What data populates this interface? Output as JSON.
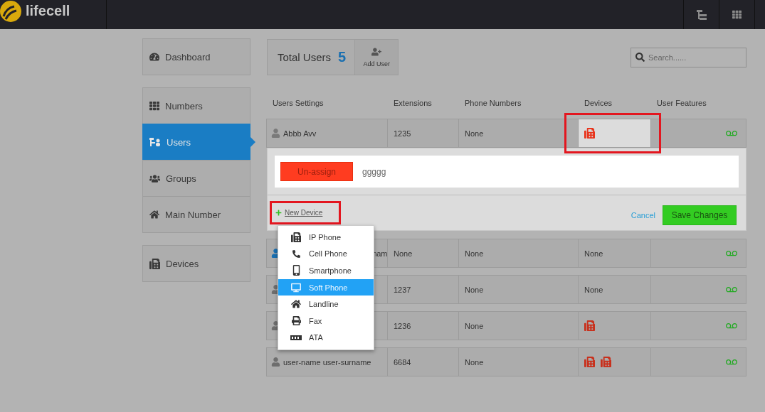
{
  "header": {
    "logo": "lifecell"
  },
  "sidebar": {
    "groups": [
      {
        "items": [
          {
            "label": "Dashboard",
            "kind": "dashboard",
            "selected": false
          }
        ]
      },
      {
        "items": [
          {
            "label": "Numbers",
            "kind": "numbers",
            "selected": false
          },
          {
            "label": "Users",
            "kind": "users",
            "selected": true
          },
          {
            "label": "Groups",
            "kind": "groups",
            "selected": false
          },
          {
            "label": "Main Number",
            "kind": "home",
            "selected": false
          }
        ]
      },
      {
        "items": [
          {
            "label": "Devices",
            "kind": "devices",
            "selected": false
          }
        ]
      }
    ]
  },
  "summary": {
    "label": "Total Users",
    "count": "5",
    "add_button": "Add User"
  },
  "search": {
    "placeholder": "Search......"
  },
  "table": {
    "columns": [
      "Users Settings",
      "Extensions",
      "Phone Numbers",
      "Devices",
      "User Features"
    ],
    "rows": [
      {
        "name": "Abbb Avv",
        "extension": "1235",
        "phone": "None",
        "devices": {
          "icons": [
            {
              "kind": "ip_phone"
            }
          ]
        },
        "voicemail": true,
        "expanded": true,
        "color": "#7a7a7a"
      },
      {
        "name_fragment": "nam",
        "extension": "None",
        "phone": "None",
        "devices": {
          "text": "None"
        },
        "voicemail": true,
        "expanded": false,
        "color": "#1a6fb0"
      },
      {
        "extension": "1237",
        "phone": "None",
        "devices": {
          "text": "None"
        },
        "voicemail": true,
        "expanded": false,
        "color": "#6e6e6e"
      },
      {
        "extension": "1236",
        "phone": "None",
        "devices": {
          "icons": [
            {
              "kind": "ip_phone"
            }
          ]
        },
        "voicemail": true,
        "expanded": false,
        "color": "#6e6e6e"
      },
      {
        "name": "user-name user-surname",
        "extension": "6684",
        "phone": "None",
        "devices": {
          "icons": [
            {
              "kind": "ip_phone"
            },
            {
              "kind": "ip_phone"
            }
          ]
        },
        "voicemail": true,
        "expanded": false,
        "color": "#6e6e6e"
      }
    ]
  },
  "device_panel": {
    "unassign_button": "Un-assign",
    "device_name": "ggggg",
    "new_device_link": "New Device",
    "cancel_link": "Cancel",
    "save_button": "Save Changes"
  },
  "device_menu": [
    {
      "label": "IP Phone",
      "kind": "ip_phone",
      "selected": false
    },
    {
      "label": "Cell Phone",
      "kind": "cell",
      "selected": false
    },
    {
      "label": "Smartphone",
      "kind": "smartphone",
      "selected": false
    },
    {
      "label": "Soft Phone",
      "kind": "softphone",
      "selected": true
    },
    {
      "label": "Landline",
      "kind": "landline",
      "selected": false
    },
    {
      "label": "Fax",
      "kind": "fax",
      "selected": false
    },
    {
      "label": "ATA",
      "kind": "ata",
      "selected": false
    }
  ]
}
